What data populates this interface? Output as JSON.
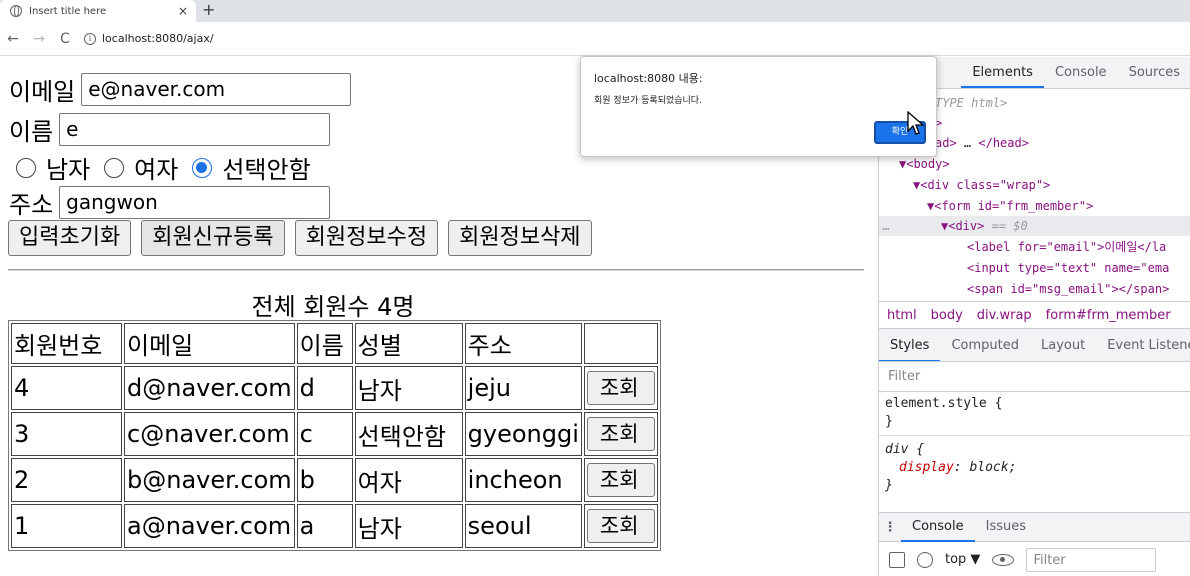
{
  "browser": {
    "tab_title": "Insert title here",
    "tab_close": "×",
    "new_tab": "+",
    "back": "←",
    "forward": "→",
    "reload": "C",
    "url": "localhost:8080/ajax/"
  },
  "form": {
    "email_label": "이메일",
    "email_value": "e@naver.com",
    "name_label": "이름",
    "name_value": "e",
    "gender_options": [
      "남자",
      "여자",
      "선택안함"
    ],
    "gender_selected": "선택안함",
    "address_label": "주소",
    "address_value": "gangwon",
    "buttons": [
      "입력초기화",
      "회원신규등록",
      "회원정보수정",
      "회원정보삭제"
    ]
  },
  "member_table": {
    "caption": "전체 회원수 4명",
    "columns": [
      "회원번호",
      "이메일",
      "이름",
      "성별",
      "주소",
      ""
    ],
    "view_label": "조회",
    "rows": [
      {
        "no": "4",
        "email": "d@naver.com",
        "name": "d",
        "gender": "남자",
        "address": "jeju"
      },
      {
        "no": "3",
        "email": "c@naver.com",
        "name": "c",
        "gender": "선택안함",
        "address": "gyeonggi"
      },
      {
        "no": "2",
        "email": "b@naver.com",
        "name": "b",
        "gender": "여자",
        "address": "incheon"
      },
      {
        "no": "1",
        "email": "a@naver.com",
        "name": "a",
        "gender": "남자",
        "address": "seoul"
      }
    ]
  },
  "alert": {
    "title": "localhost:8080 내용:",
    "message": "회원 정보가 등록되었습니다.",
    "ok": "확인"
  },
  "devtools": {
    "tabs": [
      "Elements",
      "Console",
      "Sources"
    ],
    "active_tab": "Elements",
    "dom": {
      "doctype": "TYPE html>",
      "head_close": "</head>",
      "body": "<body>",
      "div_wrap": "<div class=\"wrap\">",
      "form": "<form id=\"frm_member\">",
      "div_sel": "<div>",
      "div_sel_note": "== $0",
      "label_line": "<label for=\"email\">이메일</la",
      "input_line": "<input type=\"text\" name=\"ema",
      "span_line": "<span id=\"msg_email\"></span>"
    },
    "breadcrumbs": [
      "html",
      "body",
      "div.wrap",
      "form#frm_member"
    ],
    "style_tabs": [
      "Styles",
      "Computed",
      "Layout",
      "Event Listene"
    ],
    "filter_placeholder": "Filter",
    "rule1_selector": "element.style {",
    "rule1_close": "}",
    "rule2_selector": "div {",
    "rule2_prop": "display",
    "rule2_value": "block;",
    "rule2_close": "}",
    "console_tabs": [
      "Console",
      "Issues"
    ],
    "context": "top ▼",
    "console_filter": "Filter"
  }
}
